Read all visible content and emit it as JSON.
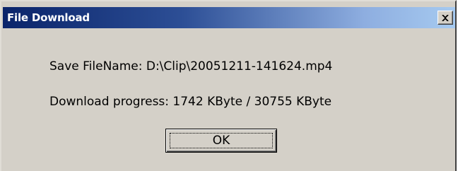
{
  "dialog": {
    "title": "File Download",
    "close_icon": "close-icon",
    "save_filename_line": "Save FileName: D:\\Clip\\20051211-141624.mp4",
    "progress_line": "Download progress: 1742 KByte / 30755 KByte",
    "ok_label": "OK"
  },
  "colors": {
    "face": "#d4d0c8",
    "title_start": "#0a246a",
    "title_end": "#a6caf0"
  }
}
